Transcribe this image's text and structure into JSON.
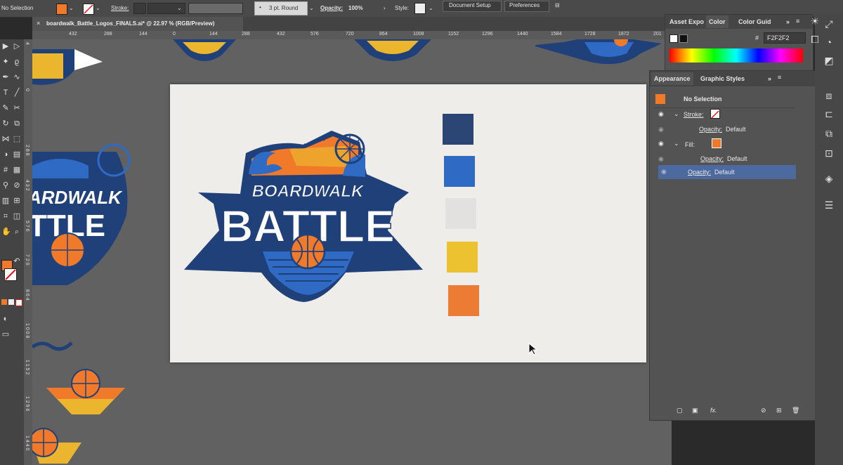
{
  "control_bar": {
    "selection": "No Selection",
    "stroke_label": "Stroke:",
    "brush": "3 pt. Round",
    "opacity_label": "Opacity:",
    "opacity_value": "100%",
    "style_label": "Style:",
    "document_setup": "Document Setup",
    "preferences": "Preferences",
    "fill_color": "#f07a2a"
  },
  "document_tab": {
    "title": "boardwalk_Battle_Logos_FINALS.ai* @ 22.97 % (RGB/Preview)",
    "close": "×"
  },
  "ruler_top": [
    "432",
    "288",
    "144",
    "0",
    "144",
    "288",
    "432",
    "576",
    "720",
    "864",
    "1008",
    "1152",
    "1296",
    "1440",
    "1584",
    "1728",
    "1872",
    "201"
  ],
  "ruler_left": [
    "4",
    "0",
    "2 8 8",
    "4 3 2",
    "5 7 6",
    "7 2 0",
    "8 6 4",
    "1 0 0 8",
    "1 1 5 2",
    "1 2 9 6",
    "1 4 4 0"
  ],
  "artboard": {
    "logo_line1": "BOARDWALK",
    "logo_line2": "BATTLE",
    "swatches": [
      "#2b4674",
      "#2f6bc4",
      "#e2e1df",
      "#ecc230",
      "#ec7b34"
    ]
  },
  "color_panel": {
    "tabs": [
      "Asset Expo",
      "Color",
      "Color Guid"
    ],
    "active_tab": "Color",
    "hex_symbol": "#",
    "hex_value": "F2F2F2"
  },
  "appearance_panel": {
    "tabs": [
      "Appearance",
      "Graphic Styles"
    ],
    "title": "No Selection",
    "stroke_label": "Stroke:",
    "stroke_opacity": "Opacity:",
    "stroke_opacity_value": "Default",
    "fill_label": "Fill:",
    "fill_opacity": "Opacity:",
    "fill_opacity_value": "Default",
    "opacity": "Opacity:",
    "opacity_value": "Default",
    "fx": "fx."
  },
  "colors": {
    "orange": "#f07a2a",
    "navy": "#20407a",
    "blue": "#2f6bc4",
    "yellow": "#ecc230",
    "panel": "#535353",
    "highlight": "#4d6aa0"
  }
}
